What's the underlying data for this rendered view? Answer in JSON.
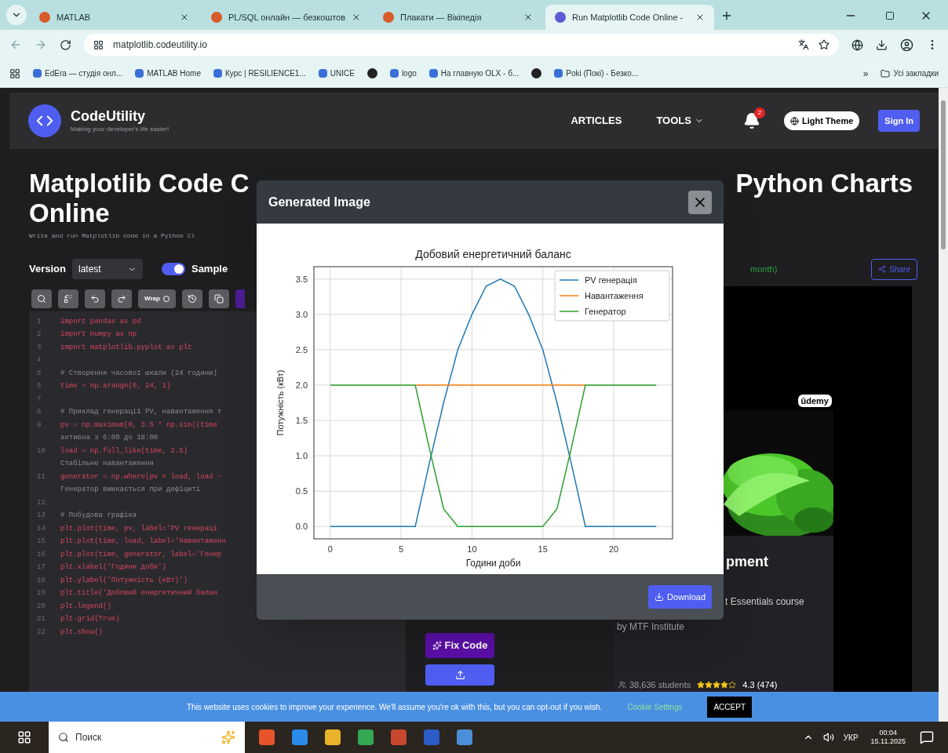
{
  "browser": {
    "tabs": [
      {
        "label": "MATLAB",
        "selected": false
      },
      {
        "label": "PL/SQL онлайн — безкоштов",
        "selected": false
      },
      {
        "label": "Плакати — Вікіпедія",
        "selected": false
      },
      {
        "label": "Run Matplotlib Code Online - ",
        "selected": true
      }
    ],
    "url": "matplotlib.codeutility.io",
    "bookmarks": [
      {
        "kind": "link",
        "label": "EdEra — студія онл..."
      },
      {
        "kind": "link",
        "label": "MATLAB Home"
      },
      {
        "kind": "link",
        "label": "Курс | RESILIENCE1..."
      },
      {
        "kind": "link",
        "label": "UNICE"
      },
      {
        "kind": "icon"
      },
      {
        "kind": "link",
        "label": "logo"
      },
      {
        "kind": "link",
        "label": "На главную OLX - б..."
      },
      {
        "kind": "icon"
      },
      {
        "kind": "link",
        "label": "Poki (Покі) - Безко..."
      }
    ],
    "more": "»",
    "all_bookmarks": "Усі закладки"
  },
  "header": {
    "brand": "CodeUtility",
    "tagline": "Making your developer's life easier!",
    "nav": [
      {
        "label": "ARTICLES",
        "dropdown": false
      },
      {
        "label": "TOOLS",
        "dropdown": true
      }
    ],
    "notification_count": "2",
    "theme_button": "Light Theme",
    "sign_in": "Sign In"
  },
  "content": {
    "title_left": "Matplotlib Code C",
    "title_right": "Python Charts",
    "title_line2": "Online",
    "subtitle": "Write and run Matplotlib code in a Python Cl",
    "version_label": "Version",
    "version_value": "latest",
    "sample": {
      "label": "Sample",
      "on": true
    },
    "stats_text": "month)",
    "share": "Share"
  },
  "editor": {
    "toolbar": [
      {
        "kind": "search"
      },
      {
        "kind": "replace"
      },
      {
        "kind": "undo"
      },
      {
        "kind": "redo"
      },
      {
        "kind": "wrap",
        "label": "Wrap"
      },
      {
        "kind": "history"
      },
      {
        "kind": "copy"
      },
      {
        "kind": "ai"
      }
    ],
    "lines": [
      {
        "number": "1",
        "text": "import pandas as pd",
        "kind": "code"
      },
      {
        "number": "2",
        "text": "import numpy as np",
        "kind": "code"
      },
      {
        "number": "3",
        "text": "import matplotlib.pyplot as plt",
        "kind": "code"
      },
      {
        "number": "4"
      },
      {
        "number": "5",
        "text": "# Створення часової шкали (24 години)",
        "kind": "comment"
      },
      {
        "number": "6",
        "text": "time = np.arange(0, 24, 1)",
        "kind": "code"
      },
      {
        "number": "7"
      },
      {
        "number": "8",
        "text": "# Приклад генерації PV, навантаження т",
        "kind": "comment"
      },
      {
        "number": "9",
        "text": "pv = np.maximum(0, 3.5 * np.sin((time",
        "kind": "code"
      },
      {
        "text": "активна з 6:00 до 18:00",
        "kind": "comment"
      },
      {
        "number": "10",
        "text": "load = np.full_like(time, 2.5)",
        "kind": "code"
      },
      {
        "text": "Стабільне навантаження",
        "kind": "comment"
      },
      {
        "number": "11",
        "text": "generator = np.where(pv < load, load -",
        "kind": "code"
      },
      {
        "text": "Генератор вмикається при дефіциті",
        "kind": "comment"
      },
      {
        "number": "12"
      },
      {
        "number": "13",
        "text": "# Побудова графіка",
        "kind": "comment"
      },
      {
        "number": "14",
        "text": "plt.plot(time, pv, label='PV генераці",
        "kind": "code"
      },
      {
        "number": "15",
        "text": "plt.plot(time, load, label='Навантаженн",
        "kind": "code"
      },
      {
        "number": "16",
        "text": "plt.plot(time, generator, label='Генер",
        "kind": "code"
      },
      {
        "number": "17",
        "text": "plt.xlabel('Години доби')",
        "kind": "code"
      },
      {
        "number": "18",
        "text": "plt.ylabel('Потужність (кВт)')",
        "kind": "code"
      },
      {
        "number": "19",
        "text": "plt.title('Добовий енергетичний балан",
        "kind": "code"
      },
      {
        "number": "20",
        "text": "plt.legend()",
        "kind": "code"
      },
      {
        "number": "21",
        "text": "plt.grid(True)",
        "kind": "code"
      },
      {
        "number": "22",
        "text": "plt.show()",
        "kind": "code"
      }
    ]
  },
  "actions": {
    "fix_code": "Fix Code"
  },
  "ad": {
    "badge": "ûdemy",
    "title": "pment",
    "description": "t Essentials course",
    "author": "by MTF Institute",
    "students": "38,636 students",
    "stars": 4,
    "rating": "4.3 (474)"
  },
  "modal": {
    "title": "Generated Image",
    "download": "Download",
    "chart_data": {
      "type": "line",
      "title": "Добовий енергетичний баланс",
      "xlabel": "Години доби",
      "ylabel": "Потужність (кВт)",
      "x": [
        0,
        1,
        2,
        3,
        4,
        5,
        6,
        7,
        8,
        9,
        10,
        11,
        12,
        13,
        14,
        15,
        16,
        17,
        18,
        19,
        20,
        21,
        22,
        23
      ],
      "series": [
        {
          "name": "PV генерація",
          "color": "#1f77b4",
          "values": [
            0,
            0,
            0,
            0,
            0,
            0,
            0,
            0.9,
            1.75,
            2.5,
            3.0,
            3.4,
            3.5,
            3.4,
            3.0,
            2.5,
            1.75,
            0.9,
            0,
            0,
            0,
            0,
            0,
            0
          ]
        },
        {
          "name": "Навантаження",
          "color": "#ff7f0e",
          "values": [
            null,
            null,
            null,
            null,
            null,
            null,
            2,
            2,
            2,
            2,
            2,
            2,
            2,
            2,
            2,
            2,
            2,
            2,
            2,
            null,
            null,
            null,
            null,
            null
          ]
        },
        {
          "name": "Генератор",
          "color": "#2ca02c",
          "values": [
            2,
            2,
            2,
            2,
            2,
            2,
            2,
            1.1,
            0.25,
            0,
            0,
            0,
            0,
            0,
            0,
            0,
            0.25,
            1.1,
            2,
            2,
            2,
            2,
            2,
            2
          ]
        }
      ],
      "xlim": [
        -1.15,
        24.15
      ],
      "ylim": [
        -0.175,
        3.675
      ],
      "xticks": [
        0,
        5,
        10,
        15,
        20
      ],
      "yticks": [
        {
          "value": 0,
          "label": "0.0"
        },
        {
          "value": 0.5,
          "label": "0.5"
        },
        {
          "value": 1,
          "label": "1.0"
        },
        {
          "value": 1.5,
          "label": "1.5"
        },
        {
          "value": 2,
          "label": "2.0"
        },
        {
          "value": 2.5,
          "label": "2.5"
        },
        {
          "value": 3,
          "label": "3.0"
        },
        {
          "value": 3.5,
          "label": "3.5"
        }
      ],
      "grid": true,
      "legend": "upper right"
    }
  },
  "cookie": {
    "text": "This website uses cookies to improve your experience. We'll assume you're ok with this, but you can opt-out if you wish.",
    "settings": "Cookie Settings",
    "accept": "ACCEPT"
  },
  "taskbar": {
    "search_placeholder": "Поиск",
    "language": "УКР",
    "time": "00:04",
    "date": "15.11.2025"
  }
}
